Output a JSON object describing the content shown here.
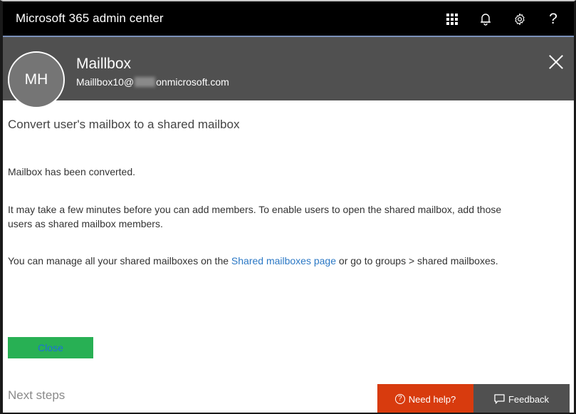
{
  "topbar": {
    "app_title": "Microsoft 365 admin center",
    "icons": [
      "app-launcher-icon",
      "notifications-icon",
      "settings-icon",
      "help-icon"
    ],
    "help_glyph": "?"
  },
  "user": {
    "initials": "MH",
    "display_name": "Maillbox",
    "email_prefix": "Maillbox10@",
    "email_suffix": "onmicrosoft.com"
  },
  "panel": {
    "title": "Convert user's mailbox to a shared mailbox",
    "message_converted": "Mailbox has been converted.",
    "message_wait": "It may take a few minutes before you can add members. To enable users to open the shared mailbox, add those users as shared mailbox members.",
    "message_manage_before": "You can manage all your shared mailboxes on the ",
    "message_manage_link": "Shared mailboxes page",
    "message_manage_after": " or go to groups > shared mailboxes.",
    "close_button": "Close",
    "next_steps": "Next steps"
  },
  "footer": {
    "need_help": "Need help?",
    "feedback": "Feedback"
  },
  "colors": {
    "topbar": "#000000",
    "header": "#505050",
    "close_button": "#28b054",
    "need_help": "#d83b0e",
    "feedback": "#505050",
    "link": "#2b78c5"
  }
}
